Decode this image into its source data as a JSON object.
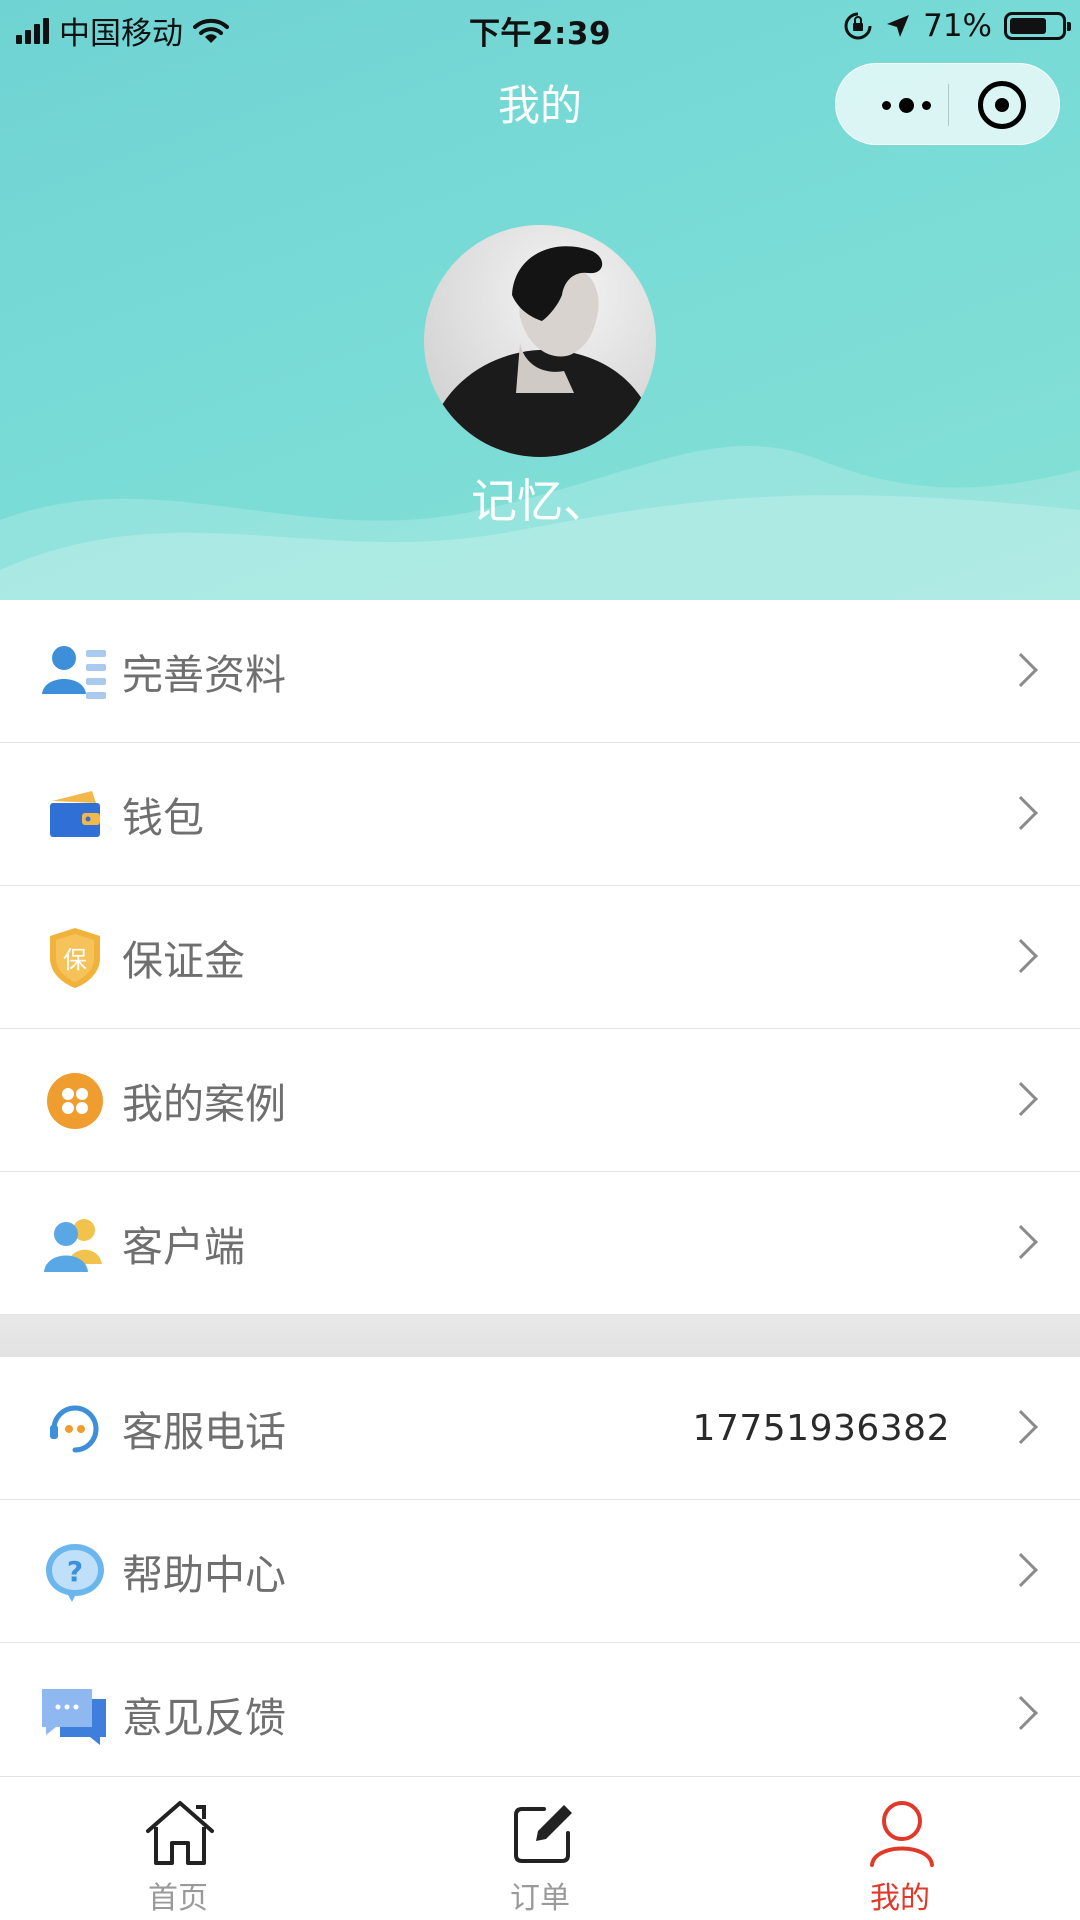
{
  "status_bar": {
    "carrier": "中国移动",
    "time": "下午2:39",
    "battery_percent": "71%",
    "battery_level": 0.71
  },
  "nav": {
    "title": "我的"
  },
  "profile": {
    "username": "记忆、"
  },
  "menu_group_1": [
    {
      "label": "完善资料",
      "icon": "profile-edit-icon"
    },
    {
      "label": "钱包",
      "icon": "wallet-icon"
    },
    {
      "label": "保证金",
      "icon": "deposit-shield-icon"
    },
    {
      "label": "我的案例",
      "icon": "cases-icon"
    },
    {
      "label": "客户端",
      "icon": "client-icon"
    }
  ],
  "menu_group_2": [
    {
      "label": "客服电话",
      "value": "17751936382",
      "icon": "customer-service-icon"
    },
    {
      "label": "帮助中心",
      "icon": "help-icon"
    },
    {
      "label": "意见反馈",
      "icon": "feedback-icon"
    }
  ],
  "tabbar": {
    "tabs": [
      {
        "label": "首页",
        "icon": "home-icon",
        "active": false
      },
      {
        "label": "订单",
        "icon": "edit-order-icon",
        "active": false
      },
      {
        "label": "我的",
        "icon": "user-icon",
        "active": true
      }
    ]
  },
  "colors": {
    "header_gradient": "#79dbd6",
    "active_tab": "#e0392a",
    "label_gray": "#6f6f6f"
  }
}
